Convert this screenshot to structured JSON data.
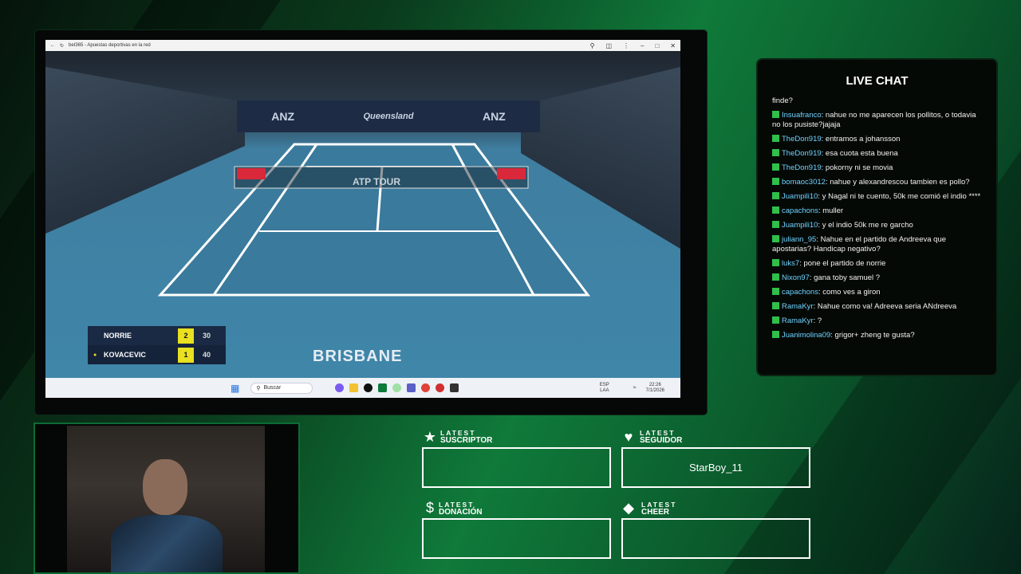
{
  "browser": {
    "tab_title": "bet365 - Apuestas deportivas en la red"
  },
  "video": {
    "banner_left": "ANZ",
    "banner_mid": "Queensland",
    "banner_right": "ANZ",
    "net_brand": "ATP TOUR",
    "venue": "BRISBANE",
    "scoreboard": {
      "players": [
        {
          "name": "NORRIE",
          "sets": "2",
          "points": "30"
        },
        {
          "name": "KOVACEVIC",
          "sets": "1",
          "points": "40",
          "serving": true
        }
      ]
    }
  },
  "taskbar": {
    "search_placeholder": "Buscar",
    "lang": "ESP",
    "lang_sub": "LAA",
    "time": "22:26",
    "date": "7/1/2026"
  },
  "chat": {
    "title": "LIVE CHAT",
    "first_line": "finde?",
    "messages": [
      {
        "user": "Insuafranco",
        "text": ": nahue no me aparecen los pollitos, o todavia no los pusiste?jajaja"
      },
      {
        "user": "TheDon919",
        "text": ": entramos a johansson"
      },
      {
        "user": "TheDon919",
        "text": ": esa cuota esta buena"
      },
      {
        "user": "TheDon919",
        "text": ": pokorny ni se movia"
      },
      {
        "user": "bomaoc3012",
        "text": ": nahue y alexandrescou tambien es pollo?"
      },
      {
        "user": "Juampili10",
        "text": ": y Nagal ni te cuento, 50k me comió el indio ****"
      },
      {
        "user": "capachons",
        "text": ": muller"
      },
      {
        "user": "Juampili10",
        "text": ": y el indio 50k me re garcho"
      },
      {
        "user": "juliann_95",
        "text": ": Nahue en el partido de Andreeva que apostarias? Handicap negativo?"
      },
      {
        "user": "luks7",
        "text": ": pone el partido de norrie"
      },
      {
        "user": "Nixon97",
        "text": ": gana toby samuel ?"
      },
      {
        "user": "capachons",
        "text": ": como ves a giron"
      },
      {
        "user": "RamaKyr",
        "text": ": Nahue como va! Adreeva seria ANdreeva"
      },
      {
        "user": "RamaKyr",
        "text": ": ?"
      },
      {
        "user": "Juanimolina09",
        "text": ": grigor+ zheng te gusta?"
      }
    ]
  },
  "widgets": {
    "subscriber": {
      "small": "LATEST",
      "label": "SUSCRIPTOR",
      "value": ""
    },
    "follower": {
      "small": "LATEST",
      "label": "SEGUIDOR",
      "value": "StarBoy_11"
    },
    "donation": {
      "small": "LATEST",
      "label": "DONACIÓN",
      "value": ""
    },
    "cheer": {
      "small": "LATEST",
      "label": "CHEER",
      "value": ""
    }
  },
  "colors": {
    "accent_green": "#0f7a3a",
    "chat_user": "#6fd2ff",
    "score_yellow": "#e8e020"
  }
}
